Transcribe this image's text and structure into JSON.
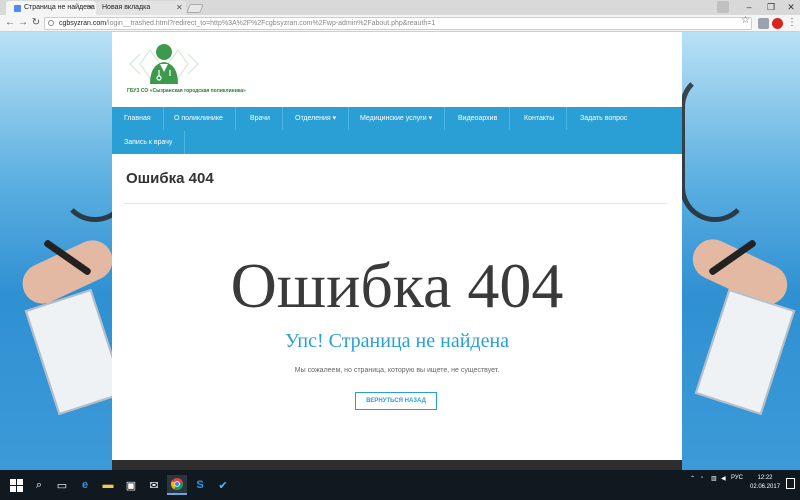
{
  "browser": {
    "tabs": [
      {
        "label": "Страница не найдена"
      },
      {
        "label": "Новая вкладка"
      }
    ],
    "address": {
      "host": "cgbsyzran.com",
      "path": "/login__trashed.html?redirect_to=http%3A%2F%2Fcgbsyzran.com%2Fwp-admin%2Fabout.php&reauth=1"
    }
  },
  "site": {
    "logo_text": "ГБУЗ СО «Сызранская городская поликлиника»",
    "nav": [
      {
        "label": "Главная"
      },
      {
        "label": "О поликлинике"
      },
      {
        "label": "Врачи"
      },
      {
        "label": "Отделения ▾"
      },
      {
        "label": "Медицинские услуги ▾"
      },
      {
        "label": "Видеоархив"
      },
      {
        "label": "Контакты"
      },
      {
        "label": "Задать вопрос"
      },
      {
        "label": "Запись к врачу"
      }
    ],
    "page_title": "Ошибка 404",
    "error_heading": "Ошибка 404",
    "error_subheading": "Упс! Страница не найдена",
    "error_message": "Мы сожалеем, но страница, которую вы ищете, не существует.",
    "back_button": "ВЕРНУТЬСЯ НАЗАД"
  },
  "taskbar": {
    "lang": "РУС",
    "time": "12:22",
    "date": "02.06.2017"
  },
  "colors": {
    "nav_bg": "#2a9fd6",
    "accent": "#2a9fd6",
    "logo_green": "#2a7d3b",
    "taskbar": "#101820"
  }
}
